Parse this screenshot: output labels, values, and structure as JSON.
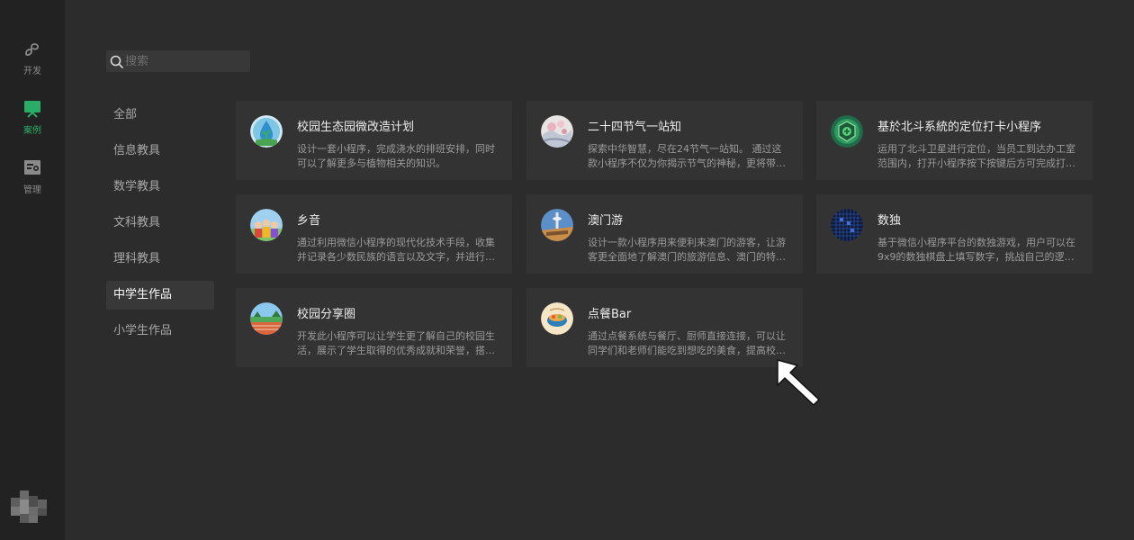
{
  "rail": [
    {
      "label": "开发",
      "icon": "mini-program-icon"
    },
    {
      "label": "案例",
      "icon": "case-monitor-icon"
    },
    {
      "label": "管理",
      "icon": "manage-icon"
    }
  ],
  "search": {
    "placeholder": "搜索"
  },
  "categories": [
    "全部",
    "信息教具",
    "数学教具",
    "文科教具",
    "理科教具",
    "中学生作品",
    "小学生作品"
  ],
  "active_category": "中学生作品",
  "cards": [
    {
      "title": "校园生态园微改造计划",
      "desc": "设计一套小程序，完成浇水的排班安排，同时可以了解更多与植物相关的知识。",
      "icon": "water-drop-plant-icon"
    },
    {
      "title": "二十四节气一站知",
      "desc": "探索中华智慧，尽在24节气一站知。 通过这款小程序不仅为你揭示节气的神秘，更将带…",
      "icon": "solar-term-painting-icon"
    },
    {
      "title": "基於北斗系統的定位打卡小程序",
      "desc": "运用了北斗卫星进行定位，当员工到达办工室范围内，打开小程序按下按键后方可完成打…",
      "icon": "beidou-badge-icon"
    },
    {
      "title": "乡音",
      "desc": "通过利用微信小程序的现代化技术手段，收集并记录各少数民族的语言以及文字，并进行…",
      "icon": "ethnic-people-icon"
    },
    {
      "title": "澳门游",
      "desc": "设计一款小程序用来便利来澳门的游客，让游客更全面地了解澳门的旅游信息、澳门的特…",
      "icon": "macau-tower-icon"
    },
    {
      "title": "数独",
      "desc": "基于微信小程序平台的数独游戏，用户可以在9x9的数独棋盘上填写数字，挑战自己的逻…",
      "icon": "sudoku-grid-icon"
    },
    {
      "title": "校园分享圈",
      "desc": "开发此小程序可以让学生更了解自己的校园生活，展示了学生取得的优秀成就和荣誉，搭…",
      "icon": "campus-field-icon"
    },
    {
      "title": "点餐Bar",
      "desc": "通过点餐系统与餐厅、厨师直接连接，可以让同学们和老师们能吃到想吃的美食，提高校…",
      "icon": "food-bowl-icon"
    }
  ],
  "colors": {
    "accent": "#2aae67",
    "background": "#2c2c2c",
    "rail": "#222222",
    "card": "#333333"
  }
}
